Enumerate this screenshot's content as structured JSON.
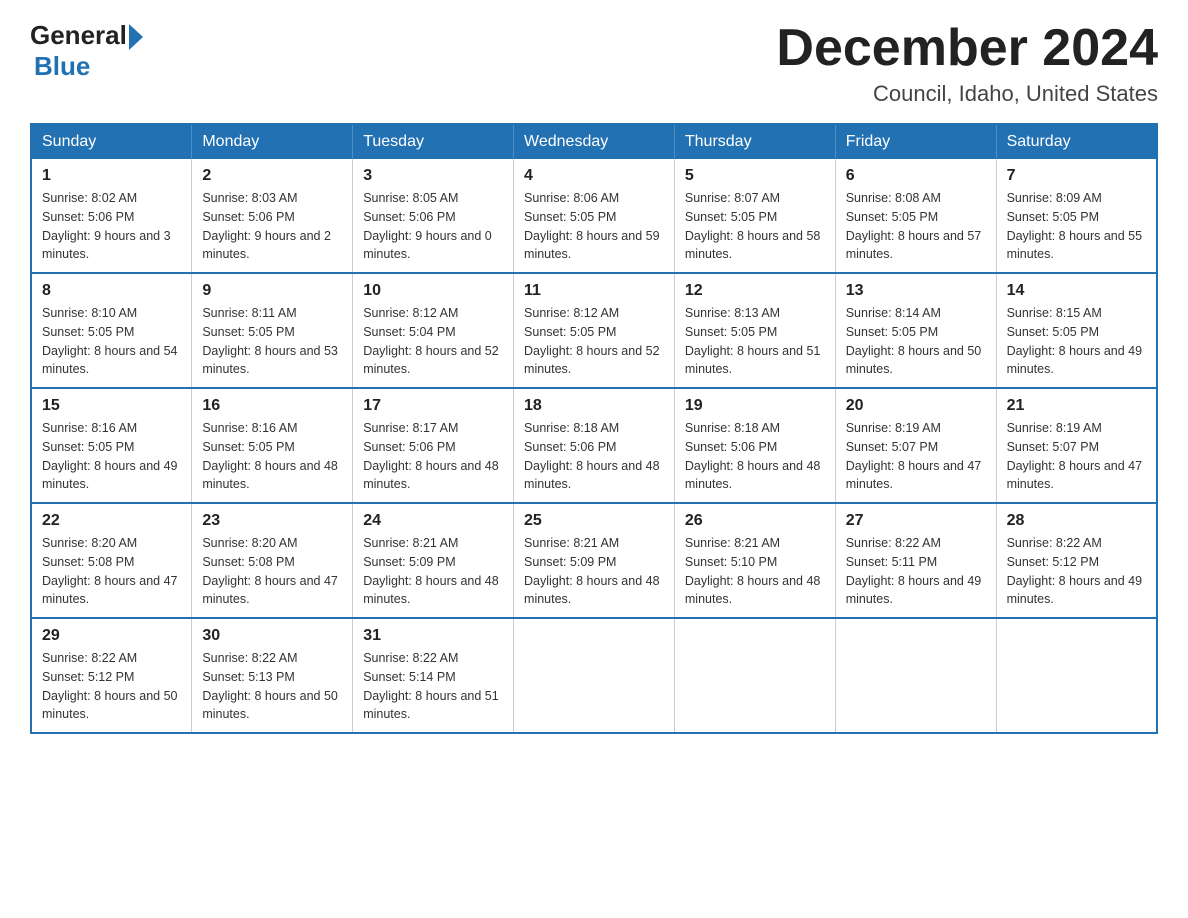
{
  "logo": {
    "general": "General",
    "blue": "Blue"
  },
  "title": "December 2024",
  "location": "Council, Idaho, United States",
  "weekdays": [
    "Sunday",
    "Monday",
    "Tuesday",
    "Wednesday",
    "Thursday",
    "Friday",
    "Saturday"
  ],
  "weeks": [
    [
      {
        "day": "1",
        "sunrise": "8:02 AM",
        "sunset": "5:06 PM",
        "daylight": "9 hours and 3 minutes."
      },
      {
        "day": "2",
        "sunrise": "8:03 AM",
        "sunset": "5:06 PM",
        "daylight": "9 hours and 2 minutes."
      },
      {
        "day": "3",
        "sunrise": "8:05 AM",
        "sunset": "5:06 PM",
        "daylight": "9 hours and 0 minutes."
      },
      {
        "day": "4",
        "sunrise": "8:06 AM",
        "sunset": "5:05 PM",
        "daylight": "8 hours and 59 minutes."
      },
      {
        "day": "5",
        "sunrise": "8:07 AM",
        "sunset": "5:05 PM",
        "daylight": "8 hours and 58 minutes."
      },
      {
        "day": "6",
        "sunrise": "8:08 AM",
        "sunset": "5:05 PM",
        "daylight": "8 hours and 57 minutes."
      },
      {
        "day": "7",
        "sunrise": "8:09 AM",
        "sunset": "5:05 PM",
        "daylight": "8 hours and 55 minutes."
      }
    ],
    [
      {
        "day": "8",
        "sunrise": "8:10 AM",
        "sunset": "5:05 PM",
        "daylight": "8 hours and 54 minutes."
      },
      {
        "day": "9",
        "sunrise": "8:11 AM",
        "sunset": "5:05 PM",
        "daylight": "8 hours and 53 minutes."
      },
      {
        "day": "10",
        "sunrise": "8:12 AM",
        "sunset": "5:04 PM",
        "daylight": "8 hours and 52 minutes."
      },
      {
        "day": "11",
        "sunrise": "8:12 AM",
        "sunset": "5:05 PM",
        "daylight": "8 hours and 52 minutes."
      },
      {
        "day": "12",
        "sunrise": "8:13 AM",
        "sunset": "5:05 PM",
        "daylight": "8 hours and 51 minutes."
      },
      {
        "day": "13",
        "sunrise": "8:14 AM",
        "sunset": "5:05 PM",
        "daylight": "8 hours and 50 minutes."
      },
      {
        "day": "14",
        "sunrise": "8:15 AM",
        "sunset": "5:05 PM",
        "daylight": "8 hours and 49 minutes."
      }
    ],
    [
      {
        "day": "15",
        "sunrise": "8:16 AM",
        "sunset": "5:05 PM",
        "daylight": "8 hours and 49 minutes."
      },
      {
        "day": "16",
        "sunrise": "8:16 AM",
        "sunset": "5:05 PM",
        "daylight": "8 hours and 48 minutes."
      },
      {
        "day": "17",
        "sunrise": "8:17 AM",
        "sunset": "5:06 PM",
        "daylight": "8 hours and 48 minutes."
      },
      {
        "day": "18",
        "sunrise": "8:18 AM",
        "sunset": "5:06 PM",
        "daylight": "8 hours and 48 minutes."
      },
      {
        "day": "19",
        "sunrise": "8:18 AM",
        "sunset": "5:06 PM",
        "daylight": "8 hours and 48 minutes."
      },
      {
        "day": "20",
        "sunrise": "8:19 AM",
        "sunset": "5:07 PM",
        "daylight": "8 hours and 47 minutes."
      },
      {
        "day": "21",
        "sunrise": "8:19 AM",
        "sunset": "5:07 PM",
        "daylight": "8 hours and 47 minutes."
      }
    ],
    [
      {
        "day": "22",
        "sunrise": "8:20 AM",
        "sunset": "5:08 PM",
        "daylight": "8 hours and 47 minutes."
      },
      {
        "day": "23",
        "sunrise": "8:20 AM",
        "sunset": "5:08 PM",
        "daylight": "8 hours and 47 minutes."
      },
      {
        "day": "24",
        "sunrise": "8:21 AM",
        "sunset": "5:09 PM",
        "daylight": "8 hours and 48 minutes."
      },
      {
        "day": "25",
        "sunrise": "8:21 AM",
        "sunset": "5:09 PM",
        "daylight": "8 hours and 48 minutes."
      },
      {
        "day": "26",
        "sunrise": "8:21 AM",
        "sunset": "5:10 PM",
        "daylight": "8 hours and 48 minutes."
      },
      {
        "day": "27",
        "sunrise": "8:22 AM",
        "sunset": "5:11 PM",
        "daylight": "8 hours and 49 minutes."
      },
      {
        "day": "28",
        "sunrise": "8:22 AM",
        "sunset": "5:12 PM",
        "daylight": "8 hours and 49 minutes."
      }
    ],
    [
      {
        "day": "29",
        "sunrise": "8:22 AM",
        "sunset": "5:12 PM",
        "daylight": "8 hours and 50 minutes."
      },
      {
        "day": "30",
        "sunrise": "8:22 AM",
        "sunset": "5:13 PM",
        "daylight": "8 hours and 50 minutes."
      },
      {
        "day": "31",
        "sunrise": "8:22 AM",
        "sunset": "5:14 PM",
        "daylight": "8 hours and 51 minutes."
      },
      null,
      null,
      null,
      null
    ]
  ],
  "labels": {
    "sunrise_prefix": "Sunrise: ",
    "sunset_prefix": "Sunset: ",
    "daylight_prefix": "Daylight: "
  }
}
